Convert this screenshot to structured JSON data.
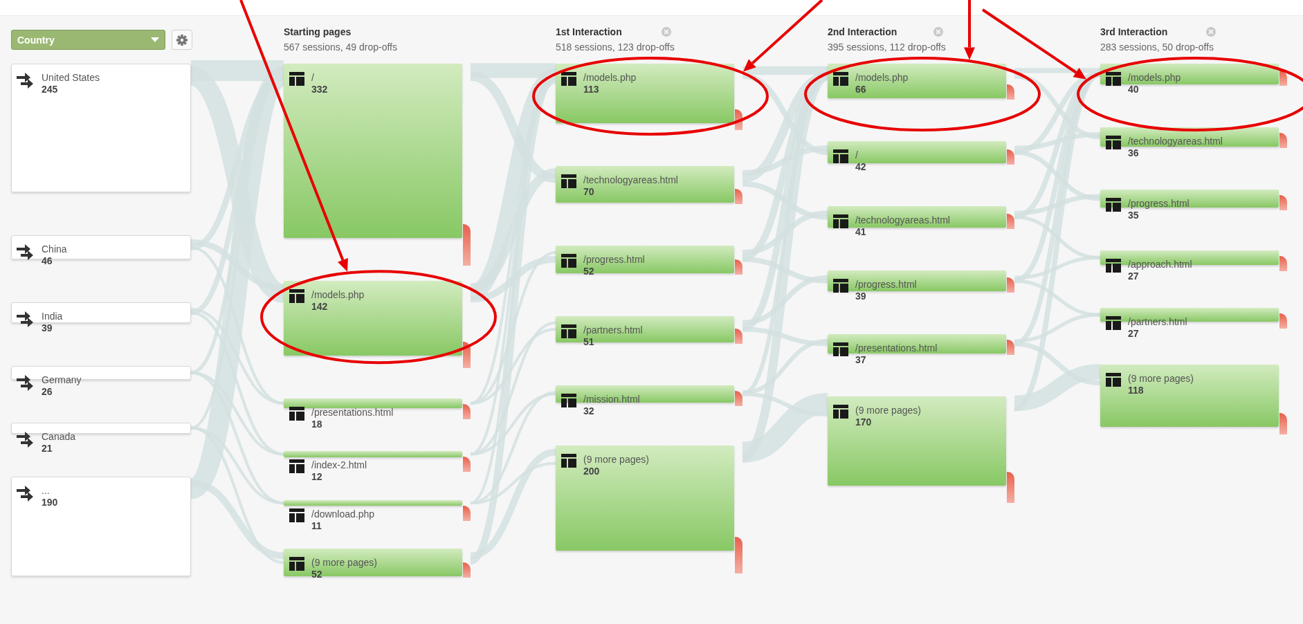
{
  "dimension": {
    "label": "Country"
  },
  "countries": [
    {
      "label": "United States",
      "count": "245"
    },
    {
      "label": "China",
      "count": "46"
    },
    {
      "label": "India",
      "count": "39"
    },
    {
      "label": "Germany",
      "count": "26"
    },
    {
      "label": "Canada",
      "count": "21"
    },
    {
      "label": "...",
      "count": "190"
    }
  ],
  "columns": [
    {
      "title": "Starting pages",
      "subtitle": "567 sessions, 49 drop-offs",
      "closable": false,
      "nodes": [
        {
          "label": "/",
          "count": "332",
          "circled": false
        },
        {
          "label": "/models.php",
          "count": "142",
          "circled": true
        },
        {
          "label": "/presentations.html",
          "count": "18",
          "circled": false
        },
        {
          "label": "/index-2.html",
          "count": "12",
          "circled": false
        },
        {
          "label": "/download.php",
          "count": "11",
          "circled": false
        },
        {
          "label": "(9 more pages)",
          "count": "52",
          "circled": false
        }
      ]
    },
    {
      "title": "1st Interaction",
      "subtitle": "518 sessions, 123 drop-offs",
      "closable": true,
      "nodes": [
        {
          "label": "/models.php",
          "count": "113",
          "circled": true
        },
        {
          "label": "/technologyareas.html",
          "count": "70",
          "circled": false
        },
        {
          "label": "/progress.html",
          "count": "52",
          "circled": false
        },
        {
          "label": "/partners.html",
          "count": "51",
          "circled": false
        },
        {
          "label": "/mission.html",
          "count": "32",
          "circled": false
        },
        {
          "label": "(9 more pages)",
          "count": "200",
          "circled": false
        }
      ]
    },
    {
      "title": "2nd Interaction",
      "subtitle": "395 sessions, 112 drop-offs",
      "closable": true,
      "nodes": [
        {
          "label": "/models.php",
          "count": "66",
          "circled": true
        },
        {
          "label": "/",
          "count": "42",
          "circled": false
        },
        {
          "label": "/technologyareas.html",
          "count": "41",
          "circled": false
        },
        {
          "label": "/progress.html",
          "count": "39",
          "circled": false
        },
        {
          "label": "/presentations.html",
          "count": "37",
          "circled": false
        },
        {
          "label": "(9 more pages)",
          "count": "170",
          "circled": false
        }
      ]
    },
    {
      "title": "3rd Interaction",
      "subtitle": "283 sessions, 50 drop-offs",
      "closable": true,
      "nodes": [
        {
          "label": "/models.php",
          "count": "40",
          "circled": true
        },
        {
          "label": "/technologyareas.html",
          "count": "36",
          "circled": false
        },
        {
          "label": "/progress.html",
          "count": "35",
          "circled": false
        },
        {
          "label": "/approach.html",
          "count": "27",
          "circled": false
        },
        {
          "label": "/partners.html",
          "count": "27",
          "circled": false
        },
        {
          "label": "(9 more pages)",
          "count": "118",
          "circled": false
        }
      ]
    }
  ]
}
